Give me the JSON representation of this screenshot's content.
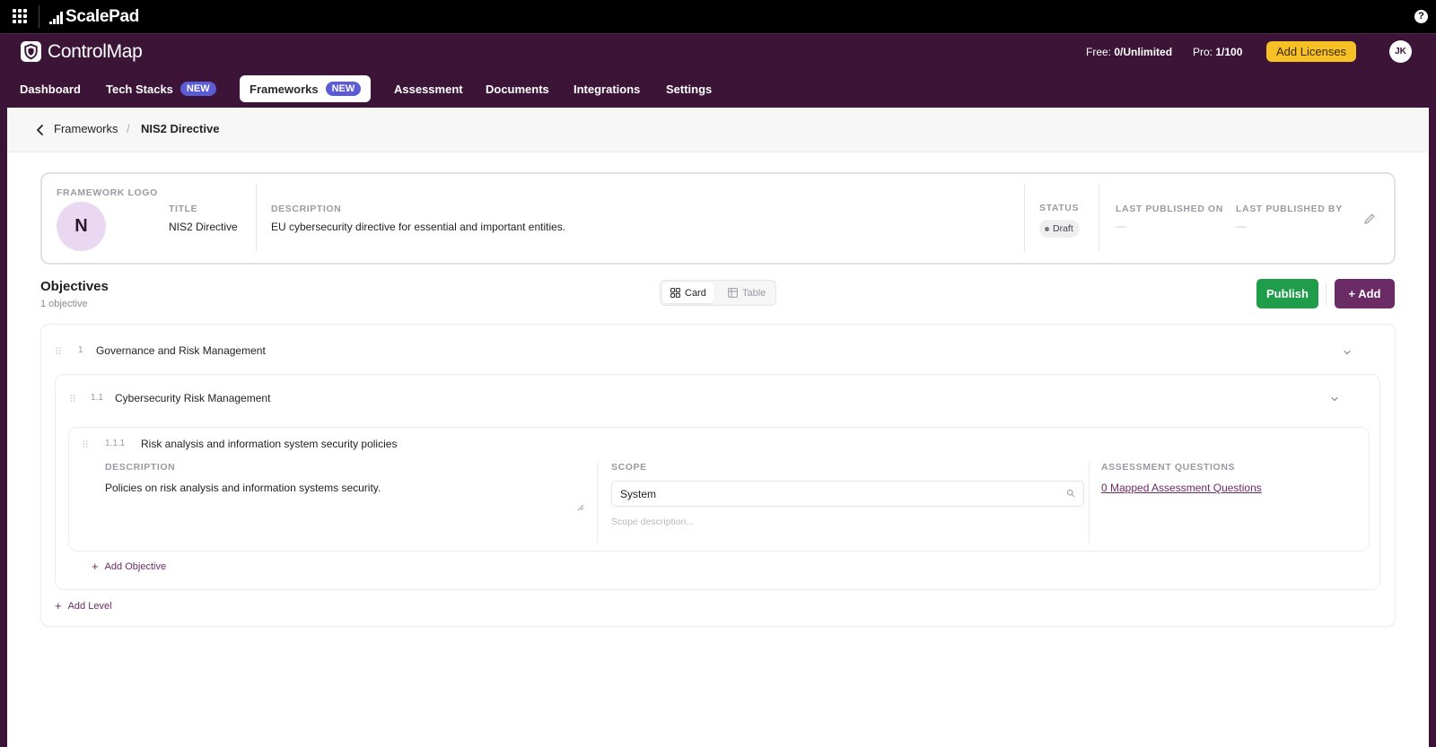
{
  "topbar": {
    "brand": "ScalePad",
    "help": "?"
  },
  "appbar": {
    "brand": "ControlMap",
    "free_label": "Free:",
    "free_value": "0/Unlimited",
    "pro_label": "Pro:",
    "pro_value": "1/100",
    "add_licenses": "Add Licenses",
    "avatar": "JK"
  },
  "nav": {
    "items": [
      {
        "label": "Dashboard"
      },
      {
        "label": "Tech Stacks",
        "badge": "NEW"
      },
      {
        "label": "Frameworks",
        "badge": "NEW"
      },
      {
        "label": "Assessment"
      },
      {
        "label": "Documents"
      },
      {
        "label": "Integrations"
      },
      {
        "label": "Settings"
      }
    ]
  },
  "breadcrumb": {
    "back": "‹",
    "parent": "Frameworks",
    "sep": "/",
    "current": "NIS2 Directive"
  },
  "framework": {
    "logo_label": "FRAMEWORK LOGO",
    "logo_letter": "N",
    "title_label": "TITLE",
    "title": "NIS2 Directive",
    "description_label": "DESCRIPTION",
    "description": "EU cybersecurity directive for essential and important entities.",
    "status_label": "STATUS",
    "status": "Draft",
    "published_on_label": "LAST PUBLISHED ON",
    "published_on": "—",
    "published_by_label": "LAST PUBLISHED BY",
    "published_by": "—"
  },
  "objectives": {
    "title": "Objectives",
    "count": "1 objective",
    "view_card": "Card",
    "view_table": "Table",
    "publish": "Publish",
    "add": "+ Add",
    "level1": {
      "num": "1",
      "title": "Governance and Risk Management"
    },
    "level2": {
      "num": "1.1",
      "title": "Cybersecurity Risk Management"
    },
    "item": {
      "num": "1.1.1",
      "title": "Risk analysis and information system security policies",
      "description_label": "DESCRIPTION",
      "description": "Policies on risk analysis and information systems security.",
      "scope_label": "SCOPE",
      "scope_value": "System",
      "scope_placeholder": "Scope description...",
      "questions_label": "ASSESSMENT QUESTIONS",
      "questions_link": "0 Mapped Assessment Questions"
    },
    "add_objective": "Add Objective",
    "add_level": "Add Level"
  },
  "colors": {
    "brand_purple": "#3b1437",
    "accent_purple": "#6b2b64",
    "publish_green": "#1f9d4b",
    "license_yellow": "#f6c026",
    "badge_blue": "#5b5bd6"
  },
  "icons": [
    "apps-grid-icon",
    "scalepad-logo-icon",
    "help-icon",
    "shield-icon",
    "chevron-left-icon",
    "pencil-icon",
    "grid-icon",
    "table-icon",
    "drag-handle-icon",
    "chevron-down-icon",
    "search-icon",
    "resize-grip-icon",
    "plus-icon"
  ]
}
